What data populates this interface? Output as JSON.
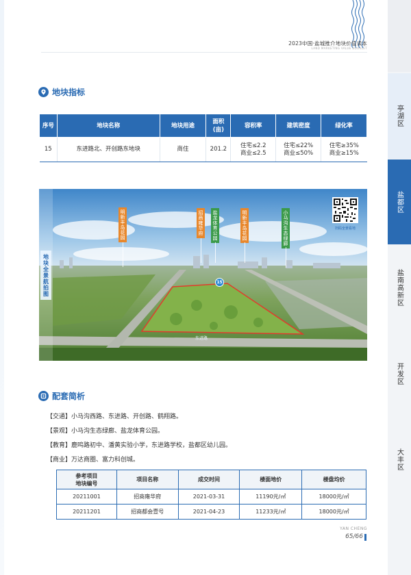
{
  "header": {
    "title": "2023中国·盐城推介地块价值读本",
    "subtitle": "LAND MARKETING VALUE BOOKLET"
  },
  "side_tabs": [
    {
      "label": "亭湖区",
      "active": false
    },
    {
      "label": "盐都区",
      "active": true
    },
    {
      "label": "盐南高新区",
      "active": false
    },
    {
      "label": "开发区",
      "active": false
    },
    {
      "label": "大丰区",
      "active": false
    }
  ],
  "indicators": {
    "heading": "地块指标",
    "headers": [
      "序号",
      "地块名称",
      "地块用途",
      "面积\n(亩)",
      "容积率",
      "建筑密度",
      "绿化率"
    ],
    "row": {
      "no": "15",
      "name": "东进路北、开创路东地块",
      "use": "商住",
      "area": "201.2",
      "far_1": "住宅≤2.2",
      "far_2": "商业≤2.5",
      "density_1": "住宅≤22%",
      "density_2": "商业≤50%",
      "green_1": "住宅≥35%",
      "green_2": "商业≥15%"
    }
  },
  "photo": {
    "side_label": "地块全景航拍图",
    "qr_caption": "扫码全景看地",
    "pin_number": "15",
    "road_label": "东进路",
    "tags": [
      {
        "text": "明新丰岛花园",
        "color": "orange"
      },
      {
        "text": "招商雍华府",
        "color": "orange"
      },
      {
        "text": "盐龙体育公园",
        "color": "green"
      },
      {
        "text": "明新丰岛花园",
        "color": "orange"
      },
      {
        "text": "小马沟生态绿廊",
        "color": "green"
      }
    ]
  },
  "facilities": {
    "heading": "配套简析",
    "items": [
      {
        "key": "【交通】",
        "text": "小马沟西路、东进路、开创路、鹤翔路。"
      },
      {
        "key": "【景观】",
        "text": "小马沟生态绿廊、盐龙体育公园。"
      },
      {
        "key": "【教育】",
        "text": "鹿鸣路初中、潘黄实验小学，东进路学校，盐都区幼儿园。"
      },
      {
        "key": "【商业】",
        "text": "万达商圈、富力科创城。"
      }
    ]
  },
  "reference": {
    "headers": [
      "参考项目\n地块编号",
      "项目名称",
      "成交时间",
      "楼面地价",
      "楼盘均价"
    ],
    "rows": [
      [
        "20211001",
        "招商雍华府",
        "2021-03-31",
        "11190元/㎡",
        "18000元/㎡"
      ],
      [
        "20211201",
        "招商都会壹号",
        "2021-04-23",
        "11233元/㎡",
        "18000元/㎡"
      ]
    ]
  },
  "footer": {
    "brand": "YAN CHENG",
    "page": "65/66"
  },
  "colors": {
    "accent": "#2a6bb3",
    "tag_orange": "#e8872b",
    "tag_green": "#3b9a49"
  }
}
